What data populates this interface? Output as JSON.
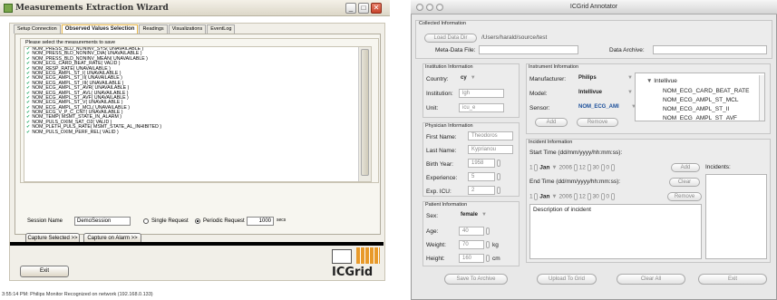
{
  "left": {
    "title": "Measurements Extraction Wizard",
    "window_buttons": [
      "_",
      "□",
      "✕"
    ],
    "tabs": [
      "Setup Connection",
      "Observed Values Selection",
      "Readings",
      "Visualizations",
      "EventLog"
    ],
    "group_title": "Please select the measurements to save",
    "measurements": [
      "NOM_PRESS_BLD_NONINV_SYS( UNAVAILABLE )",
      "NOM_PRESS_BLD_NONINV_DIA( UNAVAILABLE )",
      "NOM_PRESS_BLD_NONINV_MEAN( UNAVAILABLE )",
      "NOM_ECG_CARD_BEAT_RATE( VALID )",
      "NOM_RESP_RATE( UNAVAILABLE )",
      "NOM_ECG_AMPL_ST_I( UNAVAILABLE )",
      "NOM_ECG_AMPL_ST_II( UNAVAILABLE )",
      "NOM_ECG_AMPL_ST_III( UNAVAILABLE )",
      "NOM_ECG_AMPL_ST_AVR( UNAVAILABLE )",
      "NOM_ECG_AMPL_ST_AVL( UNAVAILABLE )",
      "NOM_ECG_AMPL_ST_AVF( UNAVAILABLE )",
      "NOM_ECG_AMPL_ST_V( UNAVAILABLE )",
      "NOM_ECG_AMPL_ST_MCL( UNAVAILABLE )",
      "NOM_ECG_V_P_C_CNT( UNAVAILABLE )",
      "NOM_TEMP( MSMT_STATE_IN_ALARM )",
      "NOM_PULS_OXIM_SAT_O2( VALID )",
      "NOM_PLETH_PULS_RATE( MSMT_STATE_AL_INHIBITED )",
      "NOM_PULS_OXIM_PERF_REL( VALID )"
    ],
    "session_label": "Session Name",
    "session_value": "DemoSession",
    "single_request": "Single Request",
    "periodic_request": "Periodic Request",
    "periodic_value": "1000",
    "periodic_unit": "secs",
    "capture_selected": "Capture Selected >>",
    "capture_alarm": "Capture on Alarm >>",
    "exit": "Exit",
    "logo_text": "ICGrid",
    "status": "3:55:14 PM: Philips Monitor Recognized on network (192.168.0.133)"
  },
  "right": {
    "title": "ICGrid Annotator",
    "collected_title": "Collected Information",
    "load_data_dir": "Load Data Dir",
    "data_dir_path": "/Users/harald/source/test",
    "meta_data_label": "Meta-Data File:",
    "data_archive_label": "Data Archive:",
    "institution_title": "Institution Information",
    "country_label": "Country:",
    "country_value": "cy",
    "institution_label": "Institution:",
    "institution_value": "lgh",
    "unit_label": "Unit:",
    "unit_value": "icu_e",
    "instrument_title": "Instrument Information",
    "manufacturer_label": "Manufacturer:",
    "manufacturer_value": "Philips",
    "model_label": "Model:",
    "model_value": "Intellivue",
    "sensor_label": "Sensor:",
    "sensor_value": "NOM_ECG_AMI",
    "add": "Add",
    "remove": "Remove",
    "tree_root": "Intellivue",
    "tree_items": [
      "NOM_ECG_CARD_BEAT_RATE",
      "NOM_ECG_AMPL_ST_MCL",
      "NOM_ECG_AMPL_ST_II",
      "NOM_ECG_AMPL_ST_AVF"
    ],
    "physician_title": "Physician Information",
    "first_name_label": "First Name:",
    "first_name_value": "Theodoros",
    "last_name_label": "Last Name:",
    "last_name_value": "Kyprianou",
    "birth_year_label": "Birth Year:",
    "birth_year_value": "1958",
    "experience_label": "Experience:",
    "experience_value": "5",
    "exp_icu_label": "Exp. ICU:",
    "exp_icu_value": "2",
    "incident_title": "Incident Information",
    "start_label": "Start Time (dd/mm/yyyy/hh:mm:ss):",
    "end_label": "End Time (dd/mm/yyyy/hh:mm:ss):",
    "start_day": "1",
    "start_month": "Jan",
    "start_year": "2006",
    "start_hour": "12",
    "start_min": "30",
    "start_sec": "0",
    "end_day": "1",
    "end_month": "Jan",
    "end_year": "2006",
    "end_hour": "12",
    "end_min": "30",
    "end_sec": "0",
    "add_inc": "Add",
    "clear": "Clear",
    "remove_inc": "Remove",
    "incidents_label": "Incidents:",
    "description": "Description of incident",
    "patient_title": "Patient Information",
    "sex_label": "Sex:",
    "sex_value": "female",
    "age_label": "Age:",
    "age_value": "40",
    "weight_label": "Weight:",
    "weight_value": "70",
    "weight_unit": "kg",
    "height_label": "Height:",
    "height_value": "160",
    "height_unit": "cm",
    "save_archive": "Save To Archive",
    "upload_grid": "Upload To Grid",
    "clear_all": "Clear All",
    "exit": "Exit"
  }
}
